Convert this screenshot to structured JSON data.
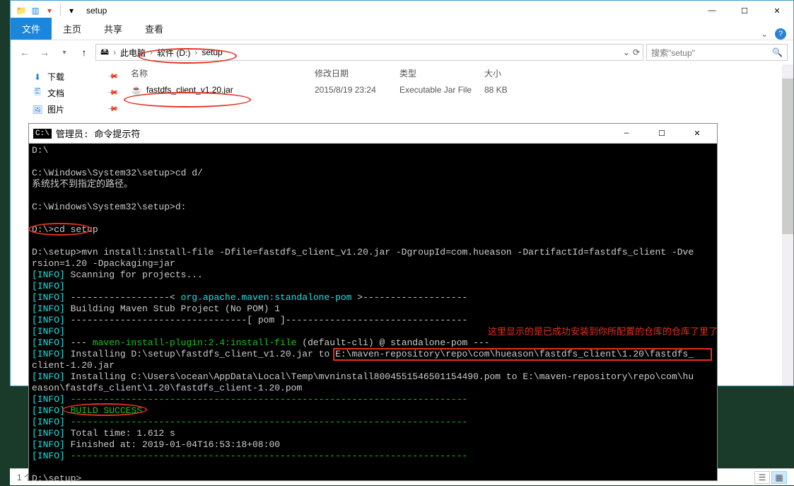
{
  "explorer": {
    "title": "setup",
    "ribbon": {
      "file": "文件",
      "tabs": [
        "主页",
        "共享",
        "查看"
      ]
    },
    "nav": {
      "breadcrumb": [
        "此电脑",
        "软件 (D:)",
        "setup"
      ]
    },
    "search_placeholder": "搜索\"setup\"",
    "sidebar": [
      {
        "icon": "⬇",
        "label": "下载",
        "color": "#2a82d8"
      },
      {
        "icon": "🖺",
        "label": "文档",
        "color": "#2a82d8"
      },
      {
        "icon": "🖼",
        "label": "图片",
        "color": "#2a82d8"
      }
    ],
    "columns": {
      "name": "名称",
      "date": "修改日期",
      "type": "类型",
      "size": "大小"
    },
    "files": [
      {
        "name": "fastdfs_client_v1.20.jar",
        "date": "2015/8/19 23:24",
        "type": "Executable Jar File",
        "size": "88 KB"
      }
    ],
    "status": "1 个"
  },
  "cmd": {
    "title": "管理员: 命令提示符",
    "lines": [
      {
        "t": "D:\\"
      },
      {
        "t": ""
      },
      {
        "t": "C:\\Windows\\System32\\setup>cd d/"
      },
      {
        "t": "系统找不到指定的路径。"
      },
      {
        "t": ""
      },
      {
        "t": "C:\\Windows\\System32\\setup>d:"
      },
      {
        "t": ""
      },
      {
        "t": "D:\\>cd setup"
      },
      {
        "t": ""
      },
      {
        "t": "D:\\setup>mvn install:install-file -Dfile=fastdfs_client_v1.20.jar -DgroupId=com.hueason -DartifactId=fastdfs_client -Dve"
      },
      {
        "t": "rsion=1.20 -Dpackaging=jar"
      },
      {
        "seg": [
          {
            "c": "cyan",
            "t": "[INFO]"
          },
          {
            "t": " Scanning for projects..."
          }
        ]
      },
      {
        "seg": [
          {
            "c": "cyan",
            "t": "[INFO]"
          }
        ]
      },
      {
        "seg": [
          {
            "c": "cyan",
            "t": "[INFO]"
          },
          {
            "t": " ------------------< "
          },
          {
            "c": "cyan",
            "t": "org.apache.maven:standalone-pom"
          },
          {
            "t": " >-------------------"
          }
        ]
      },
      {
        "seg": [
          {
            "c": "cyan",
            "t": "[INFO]"
          },
          {
            "t": " "
          },
          {
            "c": "",
            "t": "Building Maven Stub Project (No POM) 1"
          }
        ]
      },
      {
        "seg": [
          {
            "c": "cyan",
            "t": "[INFO]"
          },
          {
            "t": " --------------------------------[ pom ]---------------------------------"
          }
        ]
      },
      {
        "seg": [
          {
            "c": "cyan",
            "t": "[INFO]"
          }
        ]
      },
      {
        "seg": [
          {
            "c": "cyan",
            "t": "[INFO]"
          },
          {
            "t": " --- "
          },
          {
            "c": "green",
            "t": "maven-install-plugin:2.4:install-file"
          },
          {
            "t": " (default-cli) @ standalone-pom ---"
          }
        ]
      },
      {
        "seg": [
          {
            "c": "cyan",
            "t": "[INFO]"
          },
          {
            "t": " Installing D:\\setup\\fastdfs_client_v1.20.jar to E:\\maven-repository\\repo\\com\\hueason\\fastdfs_client\\1.20\\fastdfs_"
          }
        ]
      },
      {
        "t": "client-1.20.jar"
      },
      {
        "seg": [
          {
            "c": "cyan",
            "t": "[INFO]"
          },
          {
            "t": " Installing C:\\Users\\ocean\\AppData\\Local\\Temp\\mvninstall8004551546501154490.pom to E:\\maven-repository\\repo\\com\\hu"
          }
        ]
      },
      {
        "t": "eason\\fastdfs_client\\1.20\\fastdfs_client-1.20.pom"
      },
      {
        "seg": [
          {
            "c": "cyan",
            "t": "[INFO]"
          },
          {
            "t": " "
          },
          {
            "c": "green",
            "t": "------------------------------------------------------------------------"
          }
        ]
      },
      {
        "seg": [
          {
            "c": "cyan",
            "t": "[INFO]"
          },
          {
            "t": " "
          },
          {
            "c": "green",
            "t": "BUILD SUCCESS"
          }
        ]
      },
      {
        "seg": [
          {
            "c": "cyan",
            "t": "[INFO]"
          },
          {
            "t": " "
          },
          {
            "c": "green",
            "t": "------------------------------------------------------------------------"
          }
        ]
      },
      {
        "seg": [
          {
            "c": "cyan",
            "t": "[INFO]"
          },
          {
            "t": " Total time: 1.612 s"
          }
        ]
      },
      {
        "seg": [
          {
            "c": "cyan",
            "t": "[INFO]"
          },
          {
            "t": " Finished at: 2019-01-04T16:53:18+08:00"
          }
        ]
      },
      {
        "seg": [
          {
            "c": "cyan",
            "t": "[INFO]"
          },
          {
            "t": " "
          },
          {
            "c": "green",
            "t": "------------------------------------------------------------------------"
          }
        ]
      },
      {
        "t": ""
      },
      {
        "t": "D:\\setup>"
      }
    ]
  },
  "annotation_text": "这里显示的是已成功安装到你所配置的仓库的仓库了里了"
}
